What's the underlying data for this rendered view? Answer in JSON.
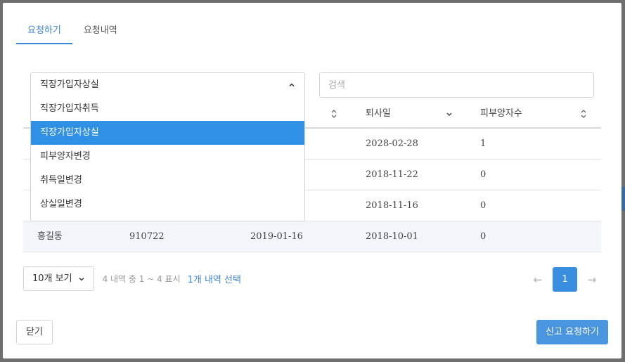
{
  "tabs": [
    {
      "label": "요청하기",
      "active": true
    },
    {
      "label": "요청내역",
      "active": false
    }
  ],
  "filter": {
    "selected": "직장가입자상실",
    "options": [
      "직장가입자취득",
      "직장가입자상실",
      "피부양자변경",
      "취득일변경",
      "상실일변경"
    ],
    "search_placeholder": "검색",
    "search_value": ""
  },
  "table": {
    "headers": [
      "",
      "",
      "",
      "퇴사일",
      "피부양자수"
    ],
    "rows": [
      {
        "name": "",
        "id": "",
        "date1": "",
        "retire": "2028-02-28",
        "deps": "1"
      },
      {
        "name": "",
        "id": "",
        "date1": "",
        "retire": "2018-11-22",
        "deps": "0"
      },
      {
        "name": "",
        "id": "",
        "date1": "",
        "retire": "2018-11-16",
        "deps": "0"
      },
      {
        "name": "홍길동",
        "id": "910722",
        "date1": "2019-01-16",
        "retire": "2018-10-01",
        "deps": "0"
      }
    ]
  },
  "footer": {
    "page_size": "10개 보기",
    "info": "4 내역 중 1 ~ 4 표시",
    "selection": "1개 내역 선택",
    "prev": "←",
    "page": "1",
    "next": "→"
  },
  "buttons": {
    "close": "닫기",
    "submit": "신고 요청하기"
  },
  "colors": {
    "accent": "#3a86d6",
    "selected_option": "#2f90e6",
    "backdrop": "#6f6f6f"
  }
}
